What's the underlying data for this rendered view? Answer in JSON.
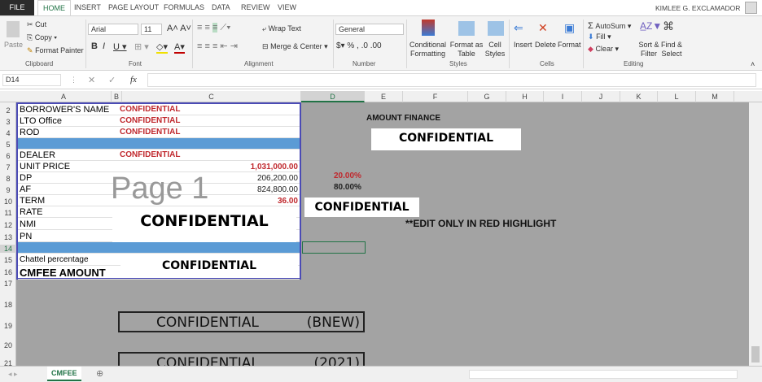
{
  "tabs": [
    "FILE",
    "HOME",
    "INSERT",
    "PAGE LAYOUT",
    "FORMULAS",
    "DATA",
    "REVIEW",
    "VIEW"
  ],
  "user": "KIMLEE G. EXCLAMADOR",
  "ribbon": {
    "paste": "Paste",
    "cut": "Cut",
    "copy": "Copy",
    "format_painter": "Format Painter",
    "clipboard": "Clipboard",
    "font_name": "Arial",
    "font_size": "11",
    "font": "Font",
    "wrap_text": "Wrap Text",
    "merge_center": "Merge & Center",
    "alignment": "Alignment",
    "number_format": "General",
    "number": "Number",
    "conditional_formatting": "Conditional Formatting",
    "format_as_table": "Format as Table",
    "cell_styles": "Cell Styles",
    "styles": "Styles",
    "insert": "Insert",
    "delete": "Delete",
    "format": "Format",
    "cells": "Cells",
    "autosum": "AutoSum",
    "fill": "Fill",
    "clear": "Clear",
    "sort_filter": "Sort & Filter",
    "find_select": "Find & Select",
    "editing": "Editing"
  },
  "formula_bar": {
    "name_box": "D14",
    "fx": "fx",
    "value": ""
  },
  "columns": [
    "A",
    "B",
    "C",
    "D",
    "E",
    "F",
    "G",
    "H",
    "I",
    "J",
    "K",
    "L",
    "M"
  ],
  "row_numbers": [
    "2",
    "3",
    "4",
    "5",
    "6",
    "7",
    "8",
    "9",
    "10",
    "11",
    "12",
    "13",
    "14",
    "15",
    "16",
    "17",
    "18",
    "19",
    "20",
    "21"
  ],
  "table": [
    {
      "label": "BORROWER'S NAME",
      "value": "CONFIDENTIAL"
    },
    {
      "label": "LTO Office",
      "value": "CONFIDENTIAL"
    },
    {
      "label": "ROD",
      "value": "CONFIDENTIAL"
    },
    {
      "label": "",
      "blue": true
    },
    {
      "label": "DEALER",
      "value": "CONFIDENTIAL"
    },
    {
      "label": "UNIT PRICE",
      "num": "1,031,000.00",
      "red": true
    },
    {
      "label": "DP",
      "num": "206,200.00",
      "pct": "20.00%",
      "pct_red": true
    },
    {
      "label": "AF",
      "num": "824,800.00",
      "pct": "80.00%"
    },
    {
      "label": "TERM",
      "num": "36.00",
      "red": true
    },
    {
      "label": "RATE"
    },
    {
      "label": "NMI"
    },
    {
      "label": "PN"
    },
    {
      "label": "",
      "blue": true
    },
    {
      "label": "Chattel percentage"
    },
    {
      "label": "CMFEE AMOUNT",
      "big": true
    }
  ],
  "page_watermark": "Page 1",
  "redactions": [
    "CONFIDENTIAL",
    "CONFIDENTIAL",
    "CONFIDENTIAL",
    "CONFIDENTIAL"
  ],
  "amount_finance": "AMOUNT FINANCE",
  "edit_note": "**EDIT ONLY IN RED HIGHLIGHT",
  "cards": [
    {
      "title": "CONFIDENTIAL",
      "tag": "(BNEW)"
    },
    {
      "title": "CONFIDENTIAL",
      "tag": "(2021)"
    }
  ],
  "sheet_tab": "CMFEE"
}
